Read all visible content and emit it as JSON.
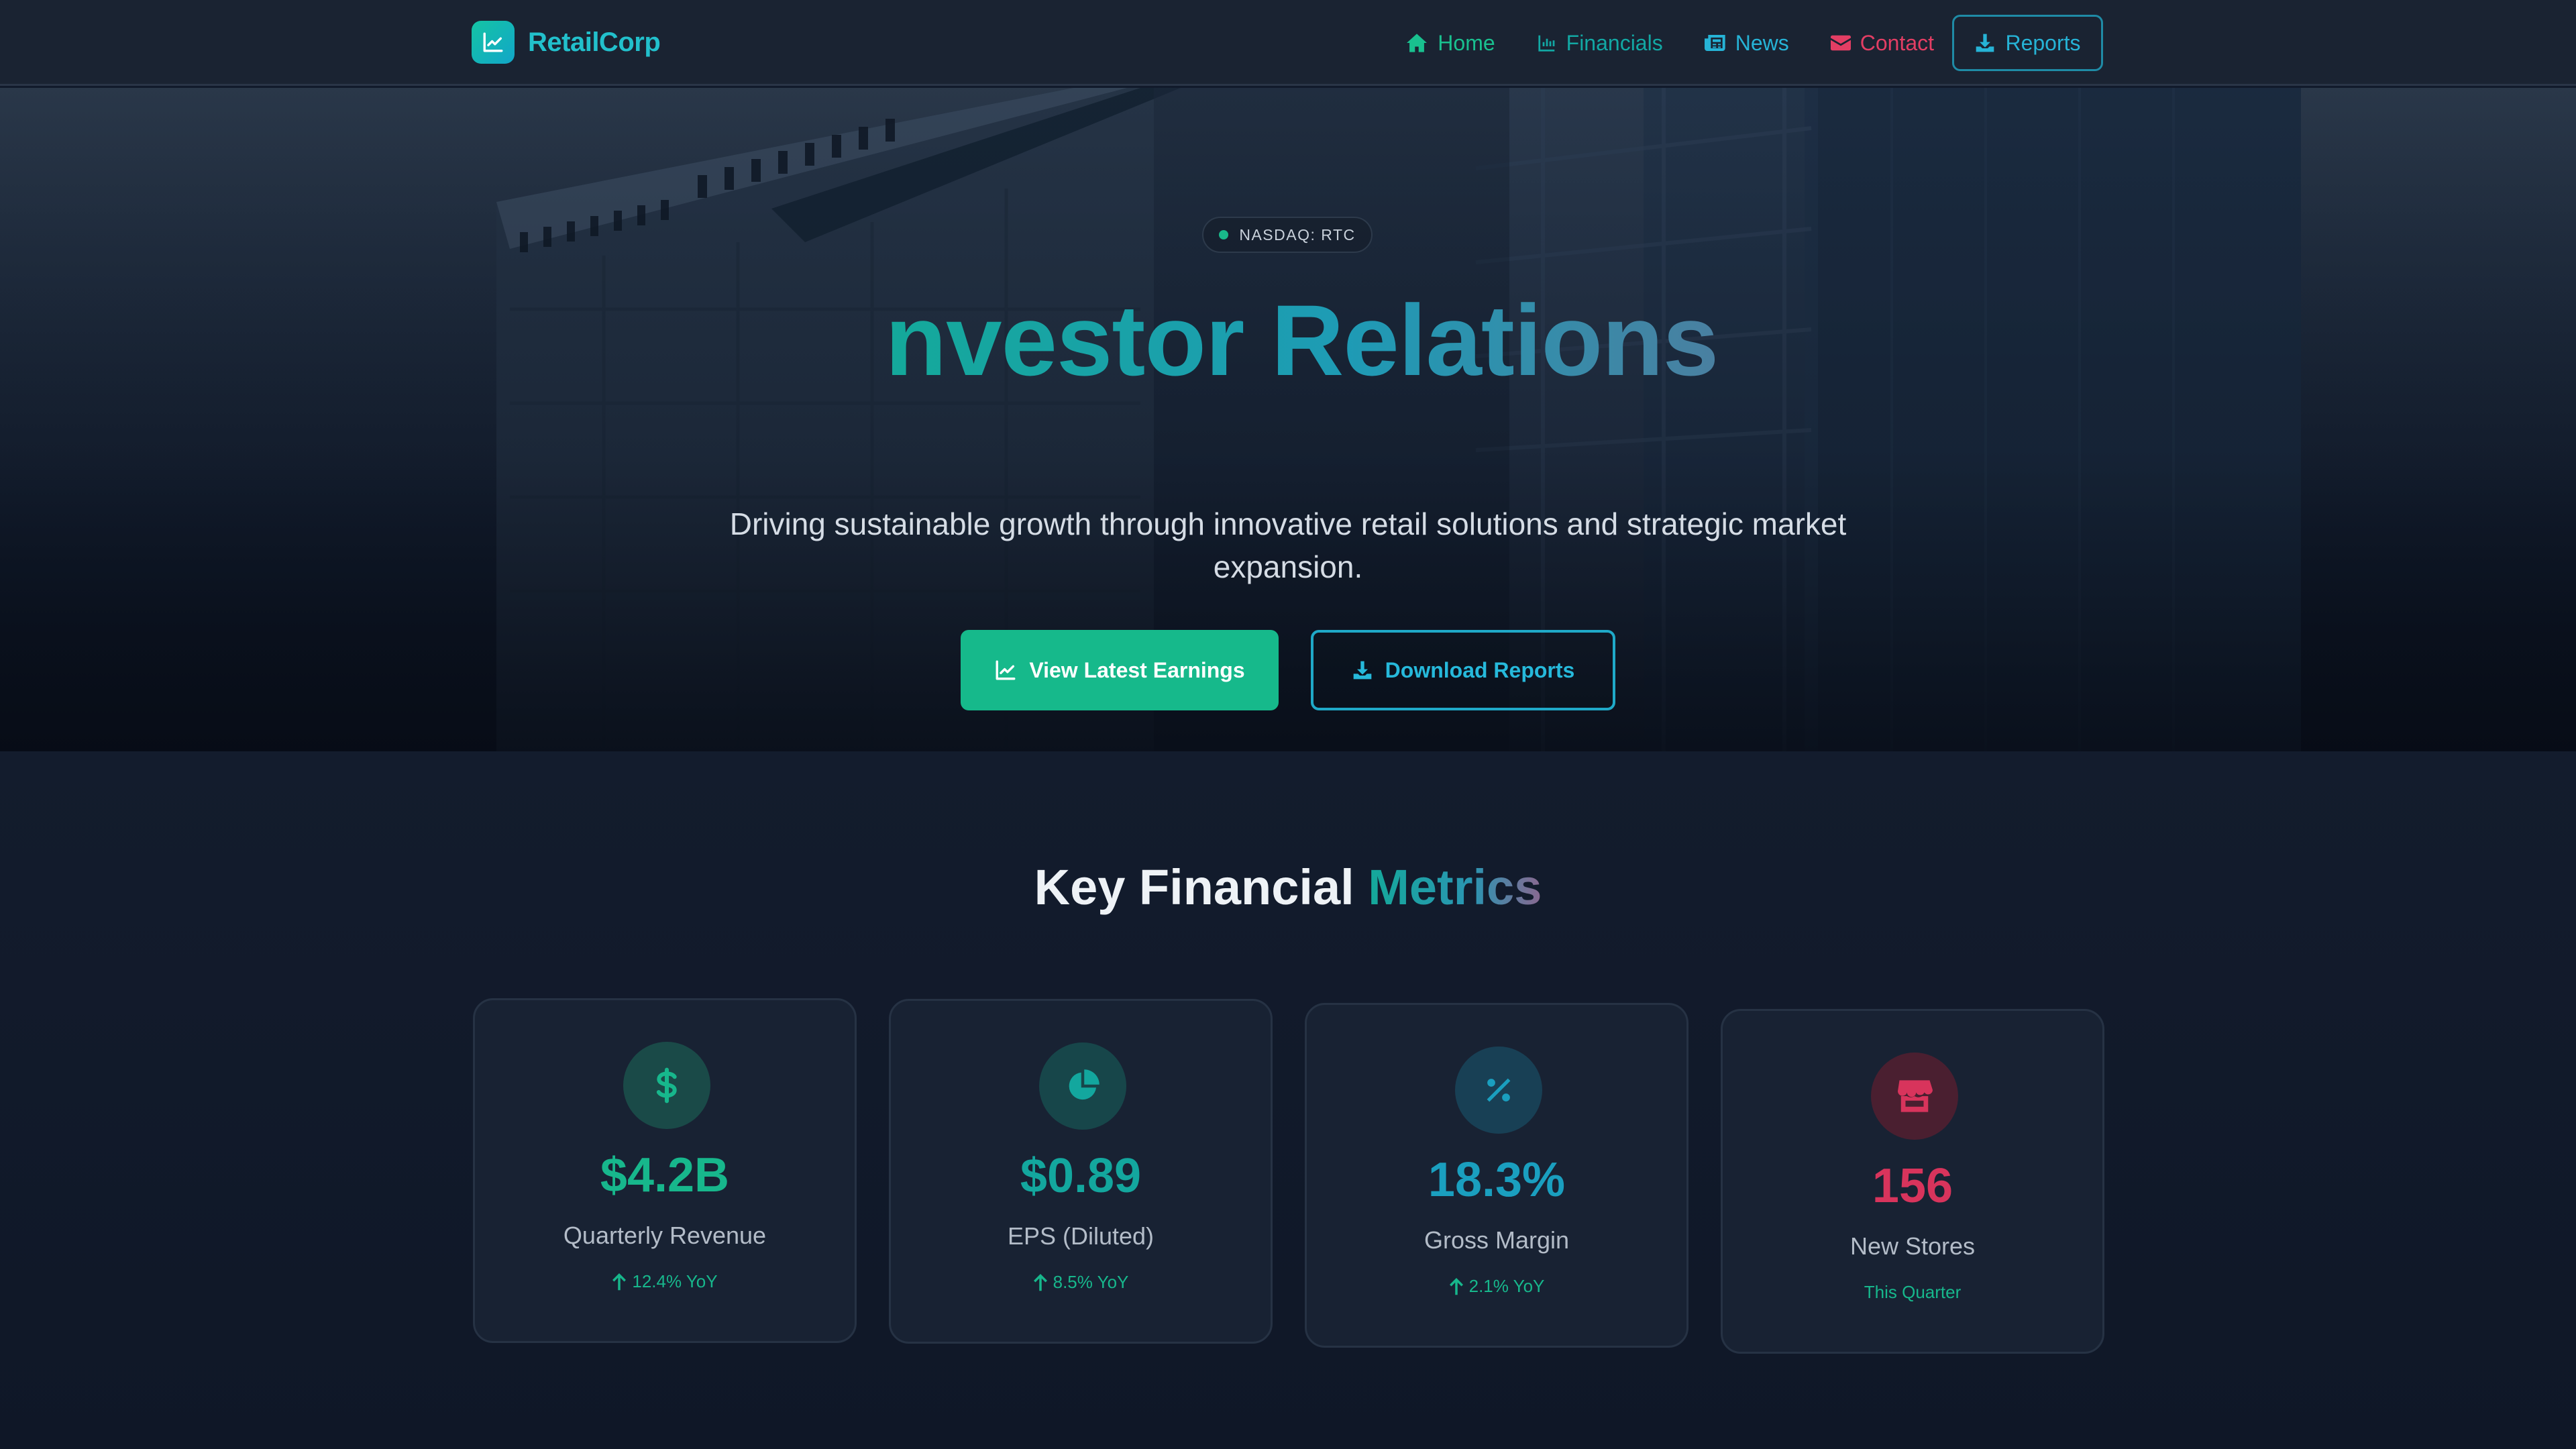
{
  "nav": {
    "brand": "RetailCorp",
    "links": [
      {
        "label": "Home",
        "icon": "home-icon",
        "color": "#19c08f"
      },
      {
        "label": "Financials",
        "icon": "chart-icon",
        "color": "#12a8a4"
      },
      {
        "label": "News",
        "icon": "newspaper-icon",
        "color": "#26b3d6"
      },
      {
        "label": "Contact",
        "icon": "envelope-icon",
        "color": "#e33e64"
      }
    ],
    "reports_button": "Reports"
  },
  "hero": {
    "ticker": "NASDAQ: RTC",
    "title": "Investor Relations",
    "subtitle": "Driving sustainable growth through innovative retail solutions and strategic market expansion.",
    "primary_button": "View Latest Earnings",
    "secondary_button": "Download Reports"
  },
  "metrics": {
    "title_main": "Key Financial",
    "title_accent": "Metrics",
    "cards": [
      {
        "value": "$4.2B",
        "label": "Quarterly Revenue",
        "sub": "12.4% YoY",
        "icon": "dollar-icon",
        "color": "#17b78c"
      },
      {
        "value": "$0.89",
        "label": "EPS (Diluted)",
        "sub": "8.5% YoY",
        "icon": "pie-chart-icon",
        "color": "#13a79e"
      },
      {
        "value": "18.3%",
        "label": "Gross Margin",
        "sub": "2.1% YoY",
        "icon": "percent-icon",
        "color": "#1a9fbf"
      },
      {
        "value": "156",
        "label": "New Stores",
        "sub": "This Quarter",
        "icon": "store-icon",
        "color": "#d8345c"
      }
    ]
  },
  "colors": {
    "primary": "#16b98b",
    "secondary": "#26b3d6",
    "accent": "#e33e64",
    "background": "#111a2b"
  }
}
